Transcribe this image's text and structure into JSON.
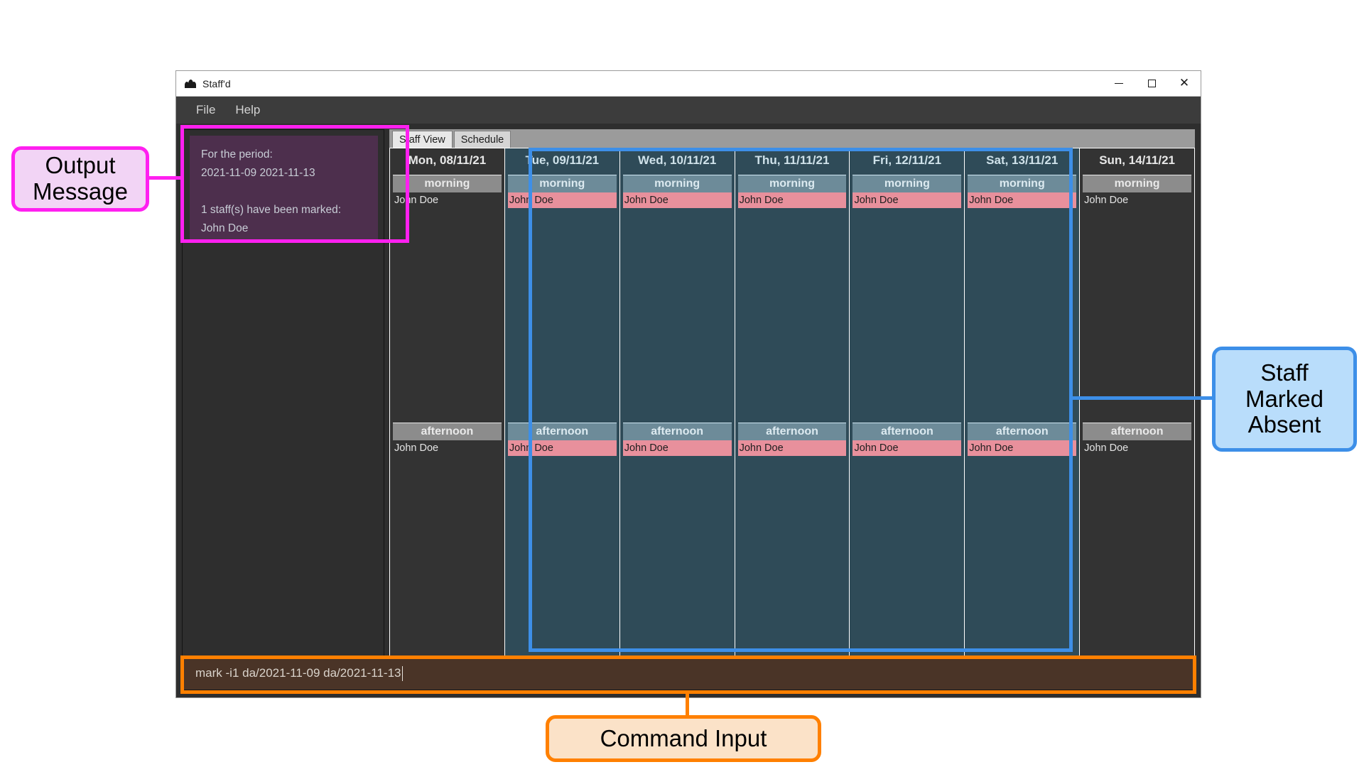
{
  "window": {
    "title": "Staff'd",
    "icon": "people-icon",
    "controls": {
      "minimize": "minimize-icon",
      "maximize": "maximize-icon",
      "close": "close-icon"
    }
  },
  "menu": {
    "items": [
      {
        "label": "File"
      },
      {
        "label": "Help"
      }
    ]
  },
  "output_message": {
    "text": "For the period:\n2021-11-09 2021-11-13\n\n1 staff(s) have been marked:\nJohn Doe"
  },
  "tabs": [
    {
      "label": "Staff View",
      "active": true
    },
    {
      "label": "Schedule",
      "active": false
    }
  ],
  "schedule": {
    "shift_labels": {
      "morning": "morning",
      "afternoon": "afternoon"
    },
    "days": [
      {
        "header": "Mon, 08/11/21",
        "absent": false,
        "morning": [
          {
            "name": "John Doe",
            "absent": false
          }
        ],
        "afternoon": [
          {
            "name": "John Doe",
            "absent": false
          }
        ]
      },
      {
        "header": "Tue, 09/11/21",
        "absent": true,
        "morning": [
          {
            "name": "John Doe",
            "absent": true
          }
        ],
        "afternoon": [
          {
            "name": "John Doe",
            "absent": true
          }
        ]
      },
      {
        "header": "Wed, 10/11/21",
        "absent": true,
        "morning": [
          {
            "name": "John Doe",
            "absent": true
          }
        ],
        "afternoon": [
          {
            "name": "John Doe",
            "absent": true
          }
        ]
      },
      {
        "header": "Thu, 11/11/21",
        "absent": true,
        "morning": [
          {
            "name": "John Doe",
            "absent": true
          }
        ],
        "afternoon": [
          {
            "name": "John Doe",
            "absent": true
          }
        ]
      },
      {
        "header": "Fri, 12/11/21",
        "absent": true,
        "morning": [
          {
            "name": "John Doe",
            "absent": true
          }
        ],
        "afternoon": [
          {
            "name": "John Doe",
            "absent": true
          }
        ]
      },
      {
        "header": "Sat, 13/11/21",
        "absent": true,
        "morning": [
          {
            "name": "John Doe",
            "absent": true
          }
        ],
        "afternoon": [
          {
            "name": "John Doe",
            "absent": true
          }
        ]
      },
      {
        "header": "Sun, 14/11/21",
        "absent": false,
        "morning": [
          {
            "name": "John Doe",
            "absent": false
          }
        ],
        "afternoon": [
          {
            "name": "John Doe",
            "absent": false
          }
        ]
      }
    ]
  },
  "command": {
    "value": "mark -i1 da/2021-11-09 da/2021-11-13",
    "placeholder": "Enter command here..."
  },
  "annotations": [
    {
      "id": "output",
      "label": "Output\nMessage",
      "color": "#ff20f0",
      "fill": "#f2d4f5"
    },
    {
      "id": "absent",
      "label": "Staff\nMarked\nAbsent",
      "color": "#3d8fe8",
      "fill": "#b9ddfb"
    },
    {
      "id": "command",
      "label": "Command Input",
      "color": "#ff8000",
      "fill": "#fbe2c8"
    }
  ],
  "colors": {
    "absent_highlight": "#e8909c",
    "absent_column": "#2f4b58",
    "output_panel": "#4d2f4d",
    "command_panel": "#4a3427",
    "app_background": "#2e2e2e"
  }
}
